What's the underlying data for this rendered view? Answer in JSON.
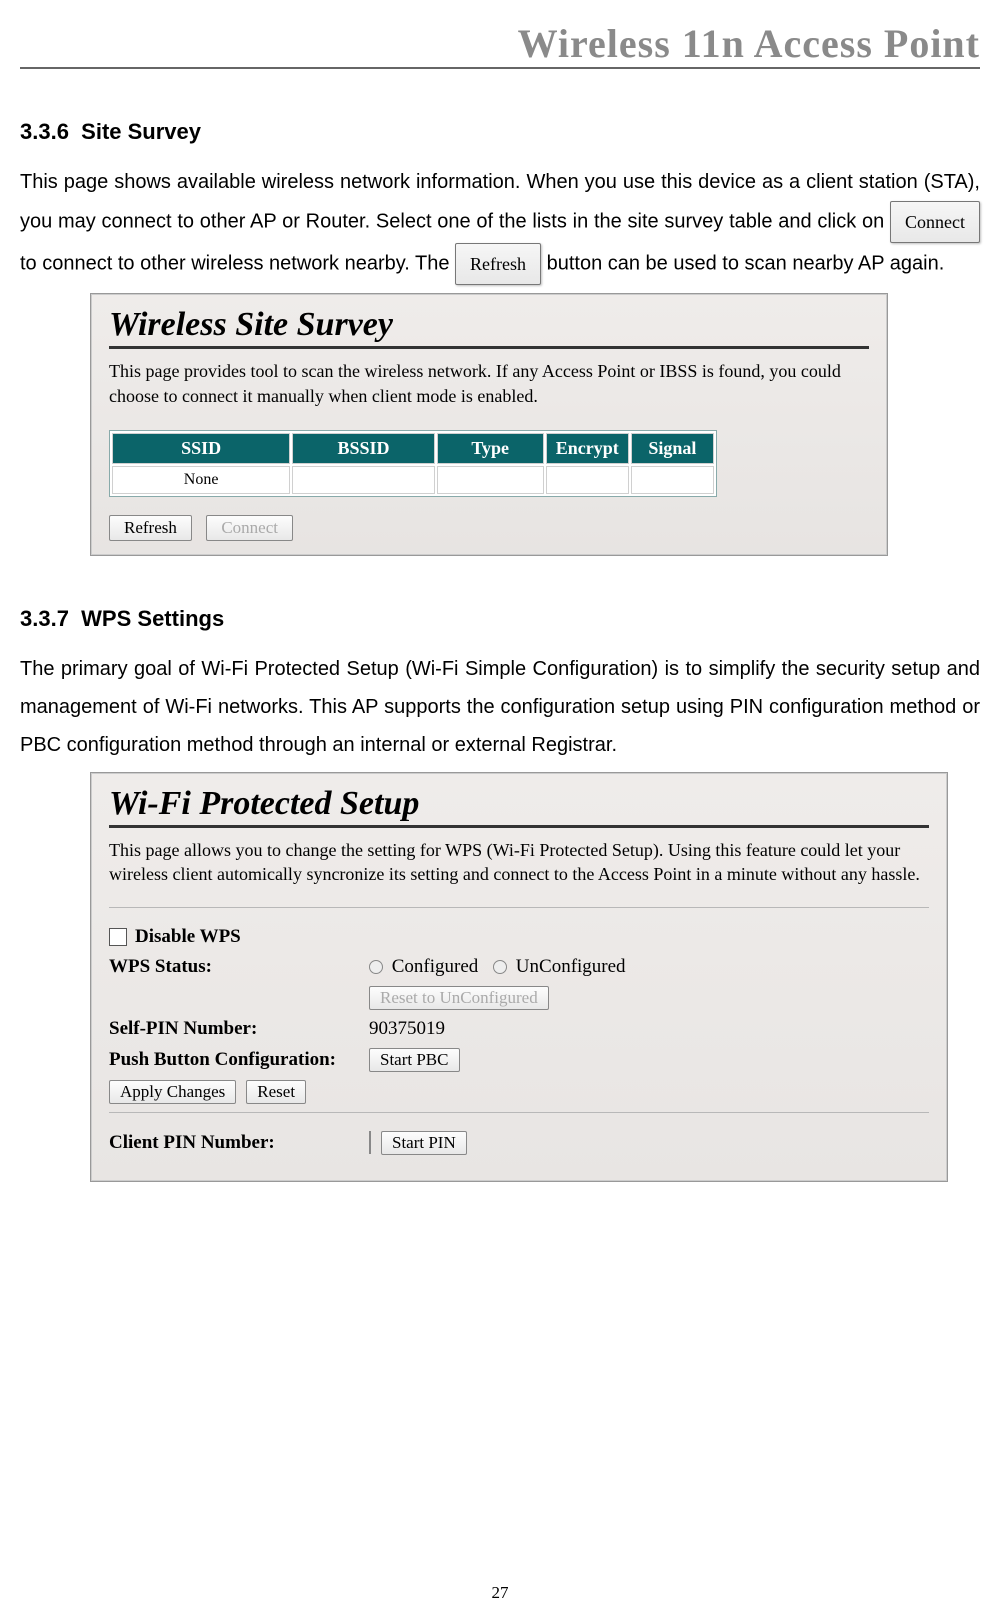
{
  "header": {
    "title": "Wireless 11n Access Point"
  },
  "section1": {
    "number": "3.3.6",
    "title": "Site Survey",
    "p1a": "This page shows available wireless network information. When you use this device as a client station (STA), you may connect to other AP or Router. Select one of the lists in the site survey table and click on ",
    "connect_btn": "Connect",
    "p1b": " to connect to other wireless network nearby. The ",
    "refresh_btn": "Refresh",
    "p1c": " button can be used to scan nearby AP again.",
    "shot": {
      "title": "Wireless Site Survey",
      "desc": "This page provides tool to scan the wireless network. If any Access Point or IBSS is found, you could choose to connect it manually when client mode is enabled.",
      "cols": [
        "SSID",
        "BSSID",
        "Type",
        "Encrypt",
        "Signal"
      ],
      "row_none": "None",
      "btn_refresh": "Refresh",
      "btn_connect": "Connect"
    }
  },
  "section2": {
    "number": "3.3.7",
    "title": "WPS Settings",
    "p1": "The primary goal of Wi-Fi Protected Setup (Wi-Fi Simple Configuration) is to simplify the security setup and management of Wi-Fi networks. This AP supports the configuration setup using PIN configuration method or PBC configuration method through an internal or external Registrar.",
    "shot": {
      "title": "Wi-Fi Protected Setup",
      "desc": "This page allows you to change the setting for WPS (Wi-Fi Protected Setup). Using this feature could let your wireless client automically syncronize its setting and connect to the Access Point in a minute without any hassle.",
      "disable_wps": "Disable WPS",
      "wps_status_label": "WPS Status:",
      "configured": "Configured",
      "unconfigured": "UnConfigured",
      "reset_unconfigured": "Reset to UnConfigured",
      "self_pin_label": "Self-PIN Number:",
      "self_pin_value": "90375019",
      "pbc_label": "Push Button Configuration:",
      "start_pbc": "Start PBC",
      "apply_changes": "Apply Changes",
      "reset": "Reset",
      "client_pin_label": "Client PIN Number:",
      "start_pin": "Start PIN"
    }
  },
  "page_number": "27"
}
